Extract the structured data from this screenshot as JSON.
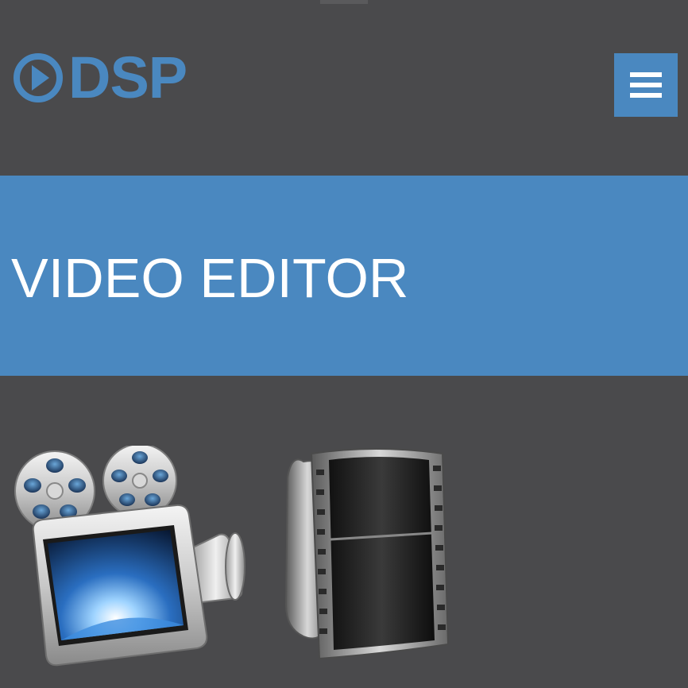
{
  "header": {
    "logo_text": "DSP",
    "menu_icon": "hamburger-menu-icon"
  },
  "banner": {
    "title": "VIDEO EDITOR"
  },
  "apps": [
    {
      "icon": "video-camera-icon"
    },
    {
      "icon": "film-strip-icon"
    }
  ],
  "colors": {
    "background": "#4a4a4c",
    "accent": "#4a88c0",
    "text_on_accent": "#ffffff"
  }
}
